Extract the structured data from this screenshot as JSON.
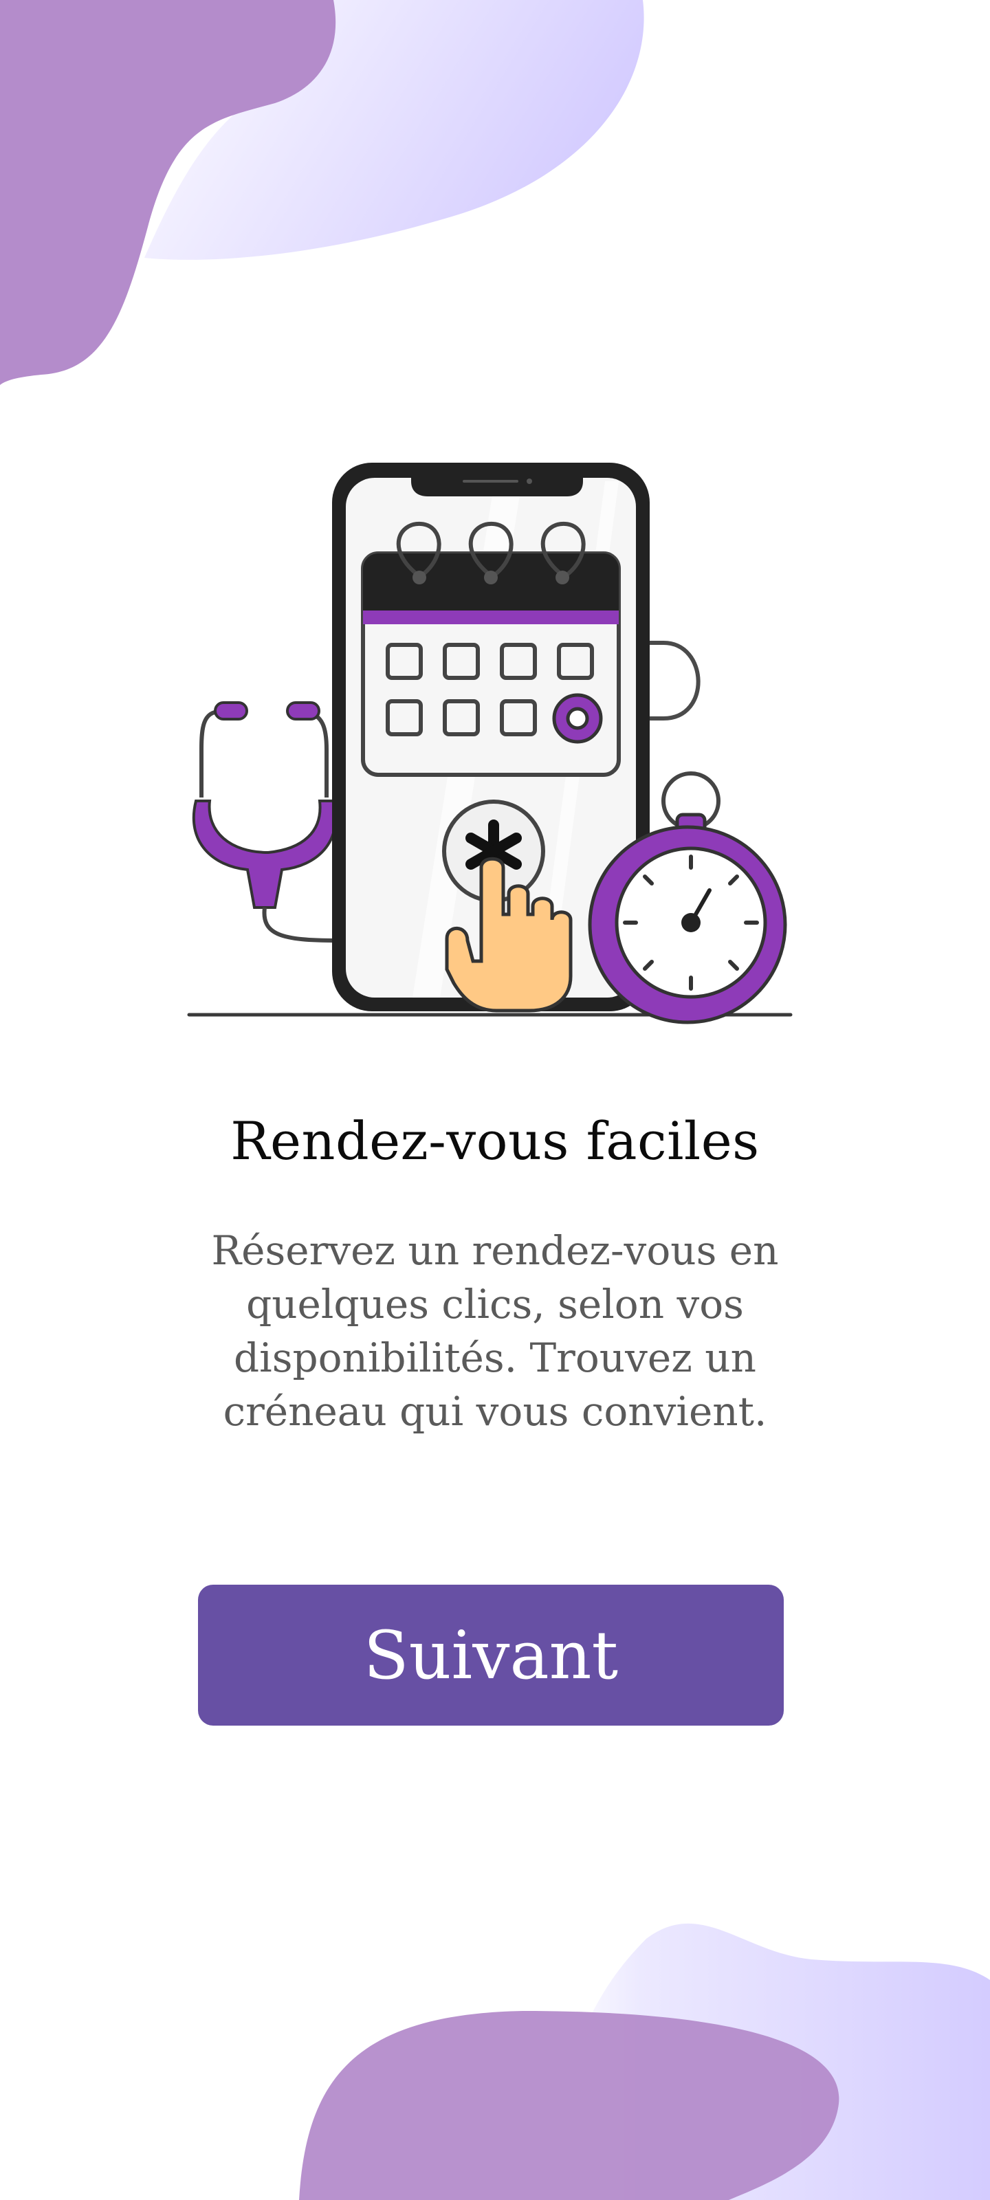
{
  "onboarding": {
    "title": "Rendez-vous faciles",
    "description": "Réservez un rendez-vous en quelques clics, selon vos disponibilités. Trouvez un créneau qui vous convient.",
    "next_button_label": "Suivant"
  },
  "colors": {
    "primary": "#6750a4",
    "accent_purple": "#8e3bb8",
    "blob_purple": "#b48ccb",
    "blob_lavender": "#d6d0ff",
    "hand": "#ffc985"
  },
  "icons": [
    "phone-icon",
    "calendar-icon",
    "stethoscope-icon",
    "stopwatch-icon",
    "hand-pointer-icon",
    "asterisk-icon"
  ]
}
